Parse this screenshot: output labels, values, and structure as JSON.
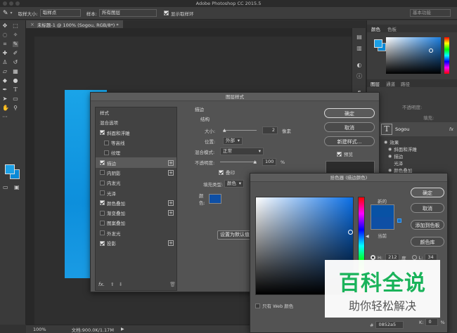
{
  "app_title": "Adobe Photoshop CC 2015.5",
  "options_bar": {
    "sample_size_label": "取样大小:",
    "sample_size_value": "取样点",
    "sample_label": "样本:",
    "sample_value": "所有图层",
    "show_ring_label": "显示取样环",
    "workspace_value": "基本功能"
  },
  "doc_tab": {
    "title": "未标题-1 @ 100% (Sogou, RGB/8*) *",
    "close": "×"
  },
  "status_bar": {
    "zoom": "100%",
    "doc_info": "文档:900.0K/1.17M"
  },
  "right_panels": {
    "color_tabs": [
      "颜色",
      "色板"
    ],
    "layers_tabs": [
      "图层",
      "通道",
      "路径"
    ],
    "opacity_label": "不透明度:",
    "fill_label": "填充:",
    "layer_name": "Sogou",
    "layer_fx": "fx",
    "effects_label": "效果",
    "effects": [
      "斜面和浮雕",
      "描边",
      "光泽",
      "颜色叠加"
    ]
  },
  "layer_style": {
    "title": "图层样式",
    "styles_header": "样式",
    "blend_options": "混合选项",
    "items": [
      {
        "label": "斜面和浮雕",
        "checked": true,
        "sub": false,
        "plus": false
      },
      {
        "label": "等高线",
        "checked": false,
        "sub": true,
        "plus": false
      },
      {
        "label": "纹理",
        "checked": false,
        "sub": true,
        "plus": false
      },
      {
        "label": "描边",
        "checked": true,
        "sub": false,
        "plus": true
      },
      {
        "label": "内阴影",
        "checked": false,
        "sub": false,
        "plus": true
      },
      {
        "label": "内发光",
        "checked": false,
        "sub": false,
        "plus": false
      },
      {
        "label": "光泽",
        "checked": false,
        "sub": false,
        "plus": false
      },
      {
        "label": "颜色叠加",
        "checked": true,
        "sub": false,
        "plus": true
      },
      {
        "label": "渐变叠加",
        "checked": false,
        "sub": false,
        "plus": true
      },
      {
        "label": "图案叠加",
        "checked": false,
        "sub": false,
        "plus": false
      },
      {
        "label": "外发光",
        "checked": false,
        "sub": false,
        "plus": false
      },
      {
        "label": "投影",
        "checked": true,
        "sub": false,
        "plus": true
      }
    ],
    "fx_label": "fx.",
    "stroke_header": "描边",
    "structure_header": "结构",
    "size_label": "大小:",
    "size_value": "2",
    "size_unit": "像素",
    "position_label": "位置:",
    "position_value": "外部",
    "blend_mode_label": "混合模式:",
    "blend_mode_value": "正常",
    "opacity_label": "不透明度:",
    "opacity_value": "100",
    "opacity_unit": "%",
    "overprint_label": "叠印",
    "fill_type_label": "填充类型:",
    "fill_type_value": "颜色",
    "color_label": "颜色:",
    "stroke_color": "#0e4fa5",
    "set_default_btn": "设置为默认值",
    "ok_btn": "确定",
    "cancel_btn": "取消",
    "new_style_btn": "新建样式...",
    "preview_label": "预览"
  },
  "color_picker": {
    "title": "拾色器 (描边颜色)",
    "new_label": "新的",
    "current_label": "当前",
    "new_color": "#0852a5",
    "current_color": "#0e4fa5",
    "ok_btn": "确定",
    "cancel_btn": "取消",
    "add_swatch_btn": "添加到色板",
    "libraries_btn": "颜色库",
    "h_label": "H:",
    "h_value": "212",
    "h_unit": "度",
    "l_label": "L:",
    "l_value": "34",
    "k_label": "K:",
    "k_value": "0",
    "k_unit": "%",
    "web_only_label": "只有 Web 颜色",
    "hex_label": "#",
    "hex_value": "0852a5"
  },
  "watermark": {
    "title": "百科全说",
    "subtitle": "助你轻松解决"
  }
}
